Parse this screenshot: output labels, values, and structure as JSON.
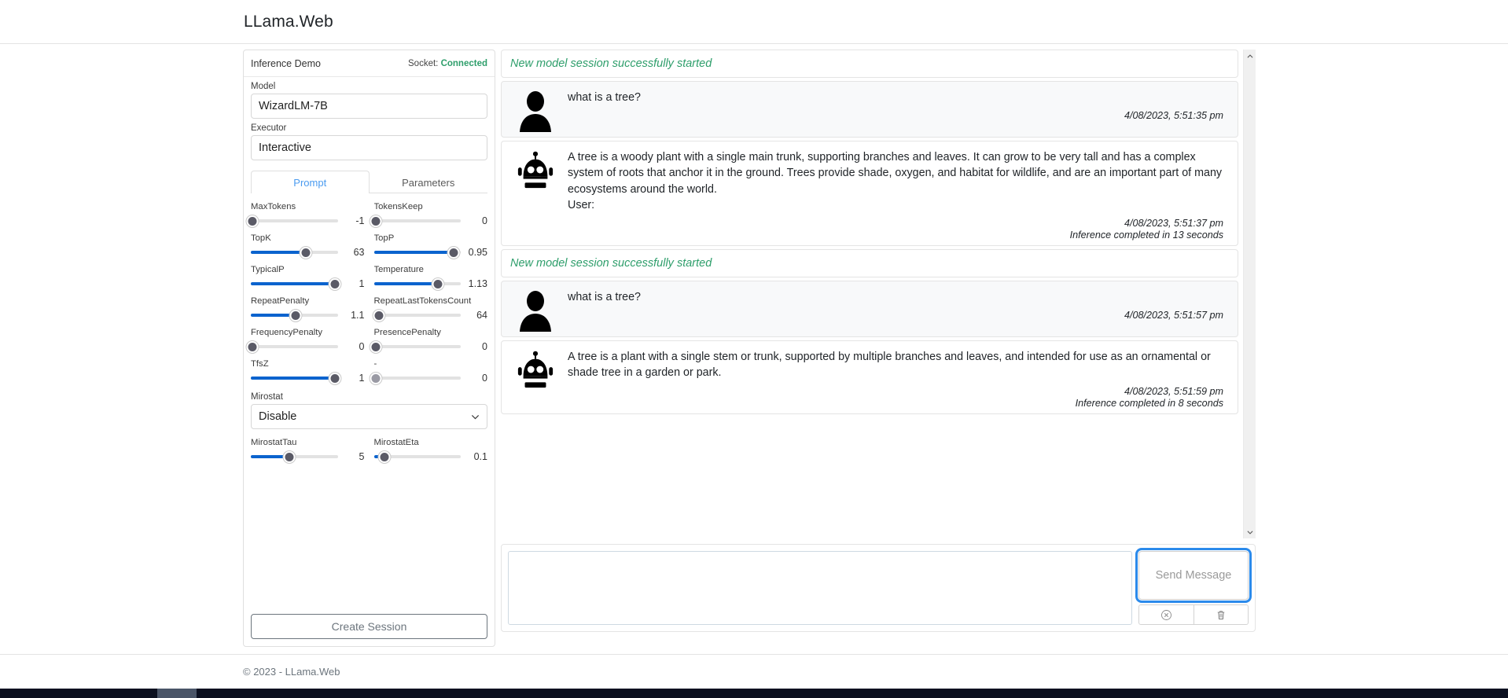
{
  "header": {
    "brand": "LLama.Web"
  },
  "footer": {
    "text": "© 2023 - LLama.Web"
  },
  "settings": {
    "card_title": "Inference Demo",
    "socket_label": "Socket:",
    "socket_value": "Connected",
    "socket_color": "#2e9e6b",
    "model_label": "Model",
    "model_value": "WizardLM-7B",
    "executor_label": "Executor",
    "executor_value": "Interactive",
    "tabs": [
      {
        "label": "Prompt",
        "active": true
      },
      {
        "label": "Parameters",
        "active": false
      }
    ],
    "sliders": [
      {
        "label": "MaxTokens",
        "value": "-1",
        "fill_pct": 0,
        "thumb_pct": 2,
        "disabled": false
      },
      {
        "label": "TokensKeep",
        "value": "0",
        "fill_pct": 0,
        "thumb_pct": 2,
        "disabled": false
      },
      {
        "label": "TopK",
        "value": "63",
        "fill_pct": 63,
        "thumb_pct": 63,
        "disabled": false
      },
      {
        "label": "TopP",
        "value": "0.95",
        "fill_pct": 92,
        "thumb_pct": 92,
        "disabled": false
      },
      {
        "label": "TypicalP",
        "value": "1",
        "fill_pct": 97,
        "thumb_pct": 97,
        "disabled": false
      },
      {
        "label": "Temperature",
        "value": "1.13",
        "fill_pct": 74,
        "thumb_pct": 74,
        "disabled": false
      },
      {
        "label": "RepeatPenalty",
        "value": "1.1",
        "fill_pct": 52,
        "thumb_pct": 52,
        "disabled": false
      },
      {
        "label": "RepeatLastTokensCount",
        "value": "64",
        "fill_pct": 4,
        "thumb_pct": 6,
        "disabled": false
      },
      {
        "label": "FrequencyPenalty",
        "value": "0",
        "fill_pct": 0,
        "thumb_pct": 2,
        "disabled": false
      },
      {
        "label": "PresencePenalty",
        "value": "0",
        "fill_pct": 0,
        "thumb_pct": 2,
        "disabled": false
      },
      {
        "label": "TfsZ",
        "value": "1",
        "fill_pct": 97,
        "thumb_pct": 97,
        "disabled": false
      },
      {
        "label": "-",
        "value": "0",
        "fill_pct": 0,
        "thumb_pct": 2,
        "disabled": true
      }
    ],
    "mirostat_label": "Mirostat",
    "mirostat_value": "Disable",
    "sliders2": [
      {
        "label": "MirostatTau",
        "value": "5",
        "fill_pct": 44,
        "thumb_pct": 44,
        "disabled": false
      },
      {
        "label": "MirostatEta",
        "value": "0.1",
        "fill_pct": 9,
        "thumb_pct": 12,
        "disabled": false
      }
    ],
    "create_session_label": "Create Session"
  },
  "chat": {
    "items": [
      {
        "kind": "system",
        "text": "New model session successfully started"
      },
      {
        "kind": "user",
        "avatar": "user-avatar-icon",
        "text": "what is a tree?",
        "timestamp": "4/08/2023, 5:51:35 pm",
        "note": ""
      },
      {
        "kind": "bot",
        "avatar": "robot-avatar-icon",
        "text": "A tree is a woody plant with a single main trunk, supporting branches and leaves. It can grow to be very tall and has a complex system of roots that anchor it in the ground. Trees provide shade, oxygen, and habitat for wildlife, and are an important part of many ecosystems around the world.\nUser:",
        "timestamp": "4/08/2023, 5:51:37 pm",
        "note": "Inference completed in 13 seconds"
      },
      {
        "kind": "system",
        "text": "New model session successfully started"
      },
      {
        "kind": "user",
        "avatar": "user-avatar-icon",
        "text": "what is a tree?",
        "timestamp": "4/08/2023, 5:51:57 pm",
        "note": ""
      },
      {
        "kind": "bot",
        "avatar": "robot-avatar-icon",
        "text": "A tree is a plant with a single stem or trunk, supported by multiple branches and leaves, and intended for use as an ornamental or shade tree in a garden or park.",
        "timestamp": "4/08/2023, 5:51:59 pm",
        "note": "Inference completed in 8 seconds"
      }
    ]
  },
  "composer": {
    "message_value": "",
    "message_placeholder": "",
    "send_label": "Send Message",
    "cancel_icon": "circle-x-icon",
    "clear_icon": "trash-icon"
  }
}
